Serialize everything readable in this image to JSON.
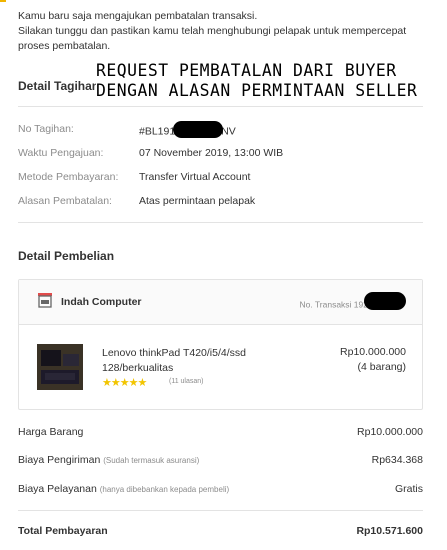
{
  "notice": {
    "line1": "Kamu baru saja mengajukan pembatalan transaksi.",
    "line2": "Silakan tunggu dan pastikan kamu telah menghubungi pelapak untuk mempercepat proses pembatalan."
  },
  "overlay": {
    "line1": "REQUEST PEMBATALAN DARI BUYER",
    "line2": "DENGAN ALASAN PERMINTAAN SELLER"
  },
  "bill": {
    "title": "Detail Tagihan",
    "rows": [
      {
        "label": "No Tagihan:",
        "value_prefix": "#BL191",
        "value_suffix": "NV"
      },
      {
        "label": "Waktu Pengajuan:",
        "value": "07 November 2019, 13:00 WIB"
      },
      {
        "label": "Metode Pembayaran:",
        "value": "Transfer Virtual Account"
      },
      {
        "label": "Alasan Pembatalan:",
        "value": "Atas permintaan pelapak"
      }
    ]
  },
  "purchase": {
    "title": "Detail Pembelian",
    "shop_name": "Indah Computer",
    "transaction_label": "No. Transaksi 192",
    "product": {
      "name": "Lenovo thinkPad T420/i5/4/ssd 128/berkualitas",
      "stars": "★★★★★",
      "rating": 5,
      "reviews": "(11 ulasan)",
      "price": "Rp10.000.000",
      "quantity": "(4 barang)"
    }
  },
  "summary": {
    "item_price_label": "Harga Barang",
    "item_price_value": "Rp10.000.000",
    "shipping_label": "Biaya Pengiriman",
    "shipping_note": "(Sudah termasuk asuransi)",
    "shipping_value": "Rp634.368",
    "service_label": "Biaya Pelayanan",
    "service_note": "(hanya dibebankan kepada pembeli)",
    "service_value": "Gratis",
    "total_label": "Total Pembayaran",
    "total_value": "Rp10.571.600"
  },
  "colors": {
    "invoice": "#cc2c5b",
    "stars": "#f2c500",
    "muted": "#8c8c8c"
  }
}
